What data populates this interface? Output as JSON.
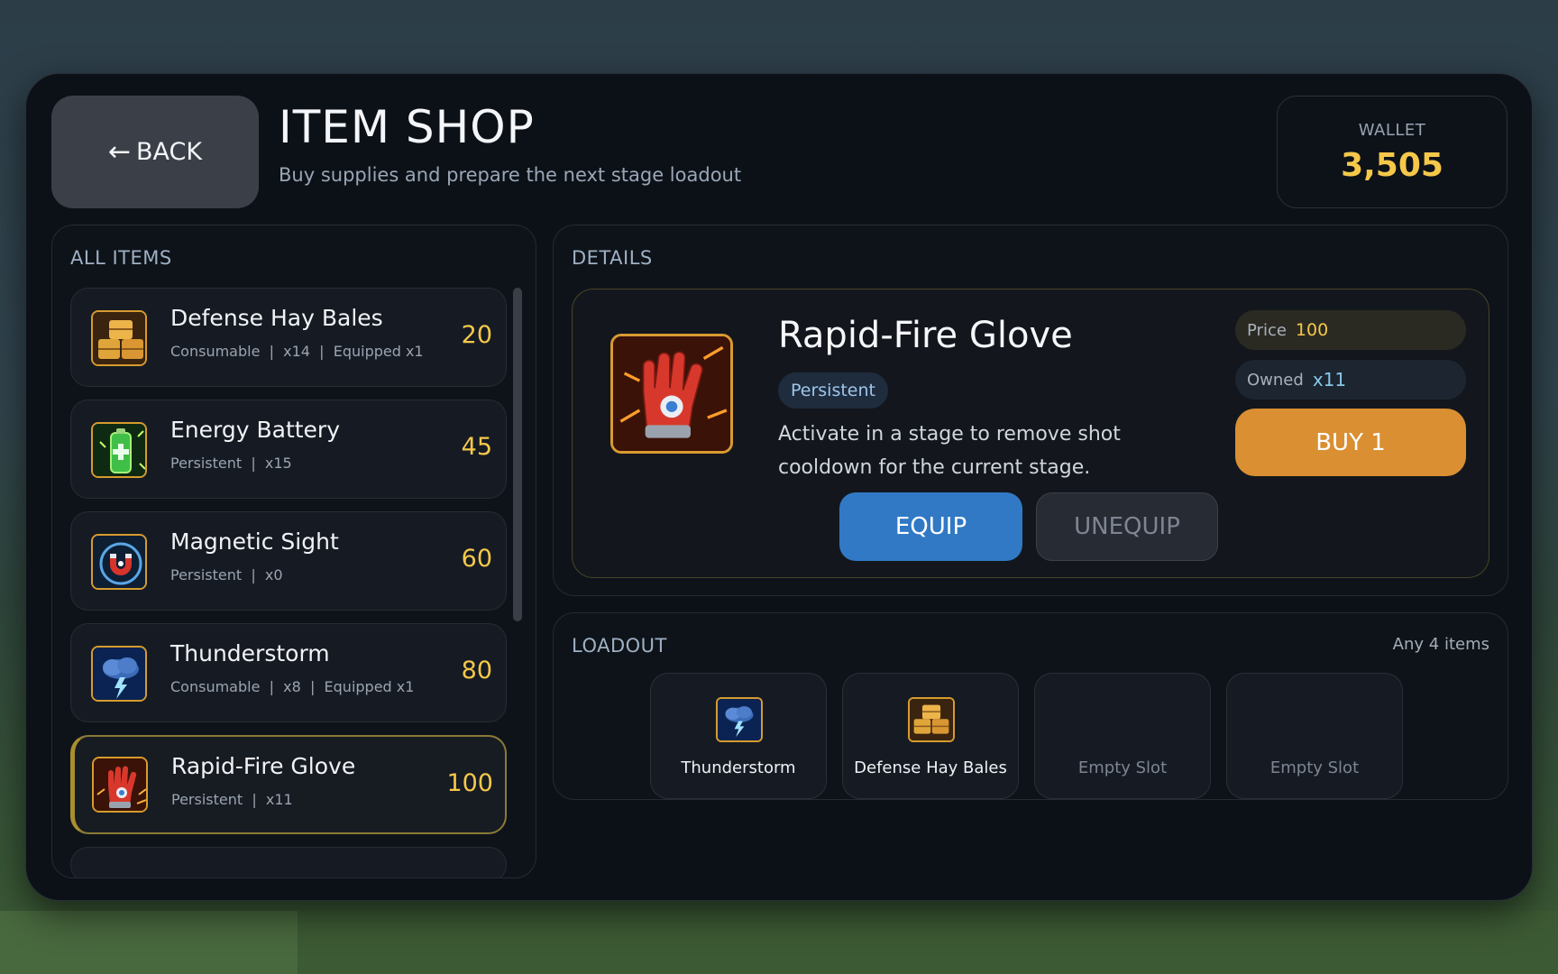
{
  "header": {
    "back_label": "BACK",
    "back_arrow": "←",
    "title": "ITEM SHOP",
    "subtitle": "Buy supplies and prepare the next stage loadout"
  },
  "wallet": {
    "label": "WALLET",
    "value": "3,505"
  },
  "all_items": {
    "label": "ALL ITEMS",
    "items": [
      {
        "name": "Defense Hay Bales",
        "meta": "Consumable  |  x14  |  Equipped x1",
        "price": "20",
        "icon": "hay-bales-icon"
      },
      {
        "name": "Energy Battery",
        "meta": "Persistent  |  x15",
        "price": "45",
        "icon": "battery-icon"
      },
      {
        "name": "Magnetic Sight",
        "meta": "Persistent  |  x0",
        "price": "60",
        "icon": "magnet-icon"
      },
      {
        "name": "Thunderstorm",
        "meta": "Consumable  |  x8  |  Equipped x1",
        "price": "80",
        "icon": "thunderstorm-icon"
      },
      {
        "name": "Rapid-Fire Glove",
        "meta": "Persistent  |  x11",
        "price": "100",
        "icon": "glove-icon",
        "selected": true
      }
    ]
  },
  "details": {
    "label": "DETAILS",
    "name": "Rapid-Fire Glove",
    "tag": "Persistent",
    "description": "Activate in a stage to remove shot cooldown for the current stage.",
    "icon": "glove-icon",
    "price_label": "Price",
    "price_value": "100",
    "owned_label": "Owned",
    "owned_value": "x11",
    "buy_label": "BUY 1",
    "equip_label": "EQUIP",
    "unequip_label": "UNEQUIP"
  },
  "loadout": {
    "label": "LOADOUT",
    "hint": "Any 4 items",
    "slots": [
      {
        "label": "Thunderstorm",
        "icon": "thunderstorm-icon"
      },
      {
        "label": "Defense Hay Bales",
        "icon": "hay-bales-icon"
      },
      {
        "label": "Empty Slot"
      },
      {
        "label": "Empty Slot"
      }
    ]
  },
  "colors": {
    "accent_gold": "#f5c84a",
    "equip_blue": "#3179c5",
    "buy_orange": "#d98f32",
    "panel_bg": "#0c1118"
  }
}
